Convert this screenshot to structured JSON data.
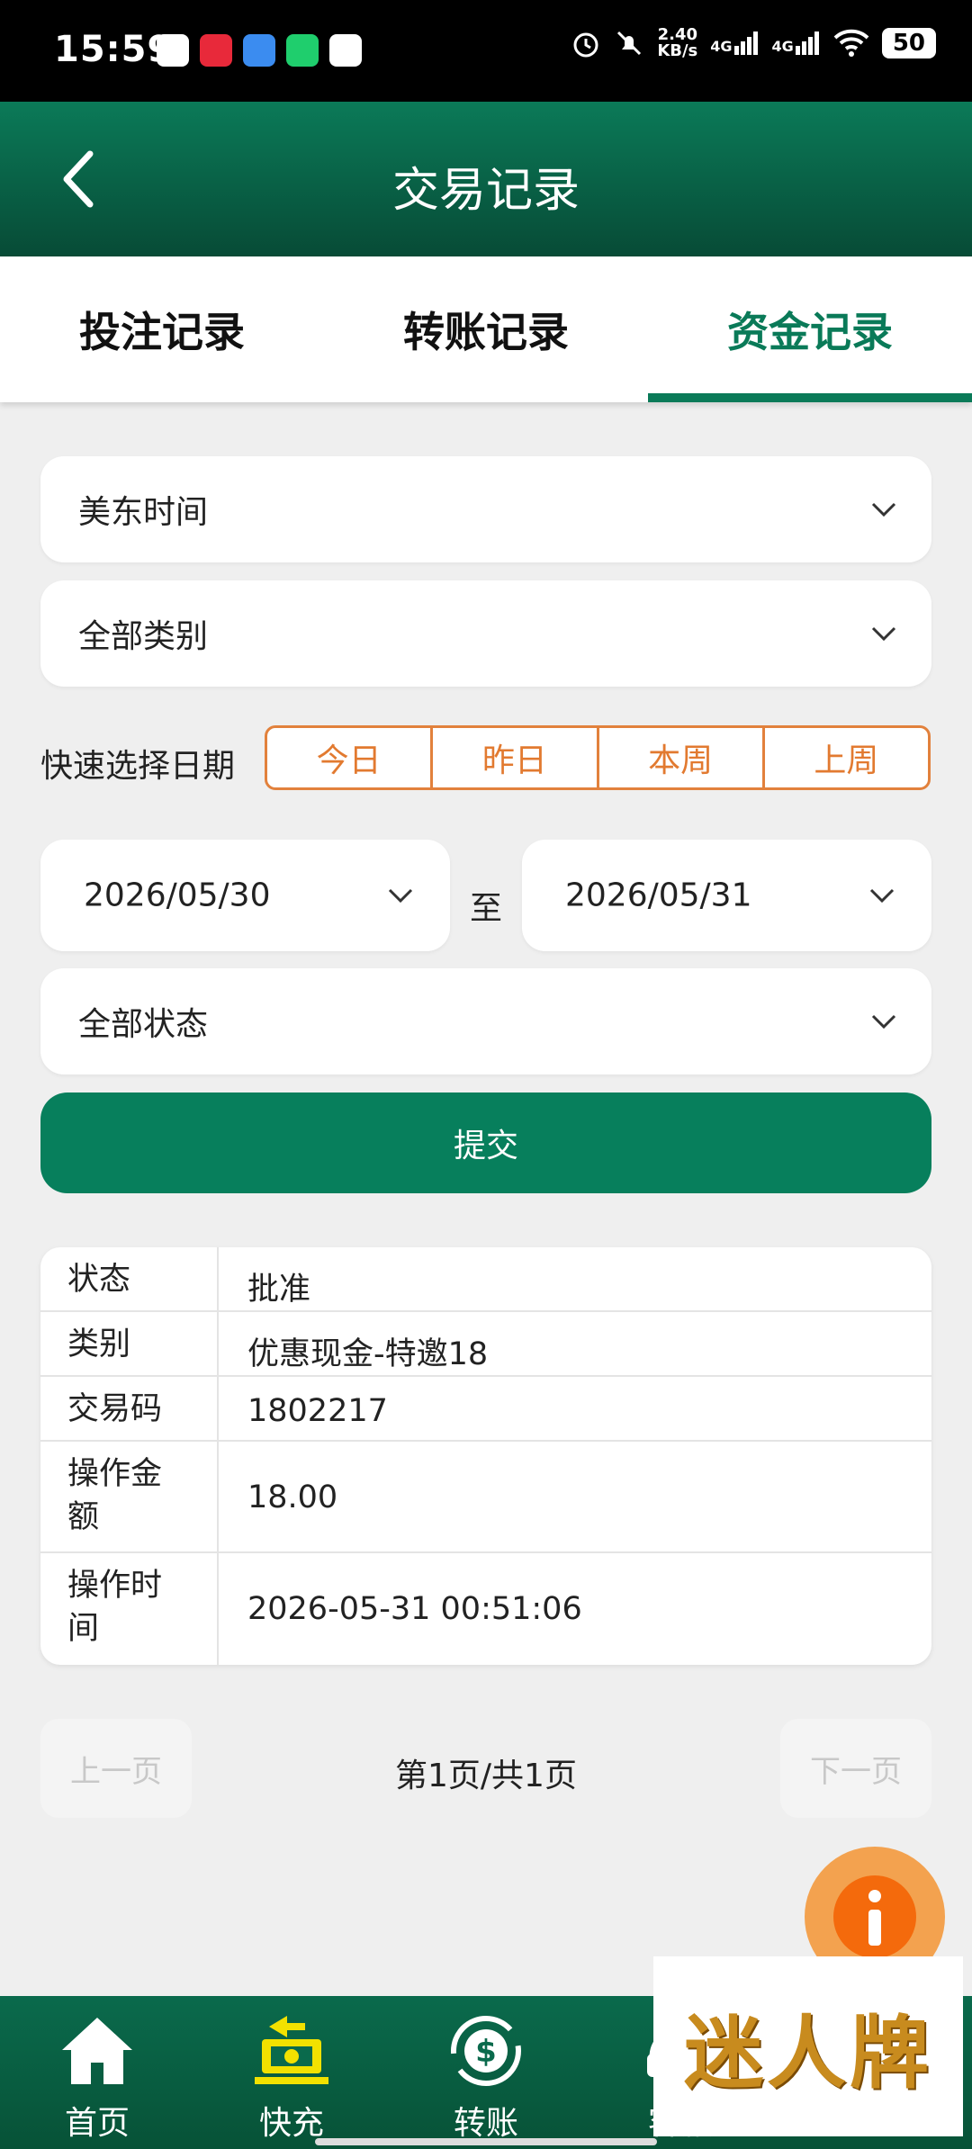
{
  "status_bar": {
    "time": "15:59",
    "speed_value": "2.40",
    "speed_unit": "KB/s",
    "network_1": "4G",
    "network_2": "4G",
    "battery": "50"
  },
  "header": {
    "title": "交易记录",
    "back_icon": "chevron-left-icon"
  },
  "tabs": [
    {
      "label": "投注记录",
      "active": false
    },
    {
      "label": "转账记录",
      "active": false
    },
    {
      "label": "资金记录",
      "active": true
    }
  ],
  "filters": {
    "timezone": "美东时间",
    "category": "全部类别",
    "quick_date_label": "快速选择日期",
    "quick_dates": [
      "今日",
      "昨日",
      "本周",
      "上周"
    ],
    "start_date": "2026/05/30",
    "to_label": "至",
    "end_date": "2026/05/31",
    "status": "全部状态",
    "submit_label": "提交"
  },
  "record": {
    "rows": [
      {
        "key": "状态",
        "value": "批准"
      },
      {
        "key": "类别",
        "value": "优惠现金-特邀18"
      },
      {
        "key": "交易码",
        "value": "1802217"
      },
      {
        "key": "操作金额",
        "value": "18.00"
      },
      {
        "key": "操作时间",
        "value": "2026-05-31 00:51:06"
      }
    ]
  },
  "pagination": {
    "prev_label": "上一页",
    "page_text": "第1页/共1页",
    "next_label": "下一页"
  },
  "bottom_nav": [
    {
      "label": "首页",
      "icon": "home-icon"
    },
    {
      "label": "快充",
      "icon": "quick-charge-icon"
    },
    {
      "label": "转账",
      "icon": "transfer-icon"
    },
    {
      "label": "客服",
      "icon": "customer-service-icon"
    }
  ],
  "watermark": {
    "text": "迷人牌"
  },
  "colors": {
    "brand_green": "#077f5c",
    "accent_orange": "#e27a30",
    "header_dark": "#074b36"
  }
}
